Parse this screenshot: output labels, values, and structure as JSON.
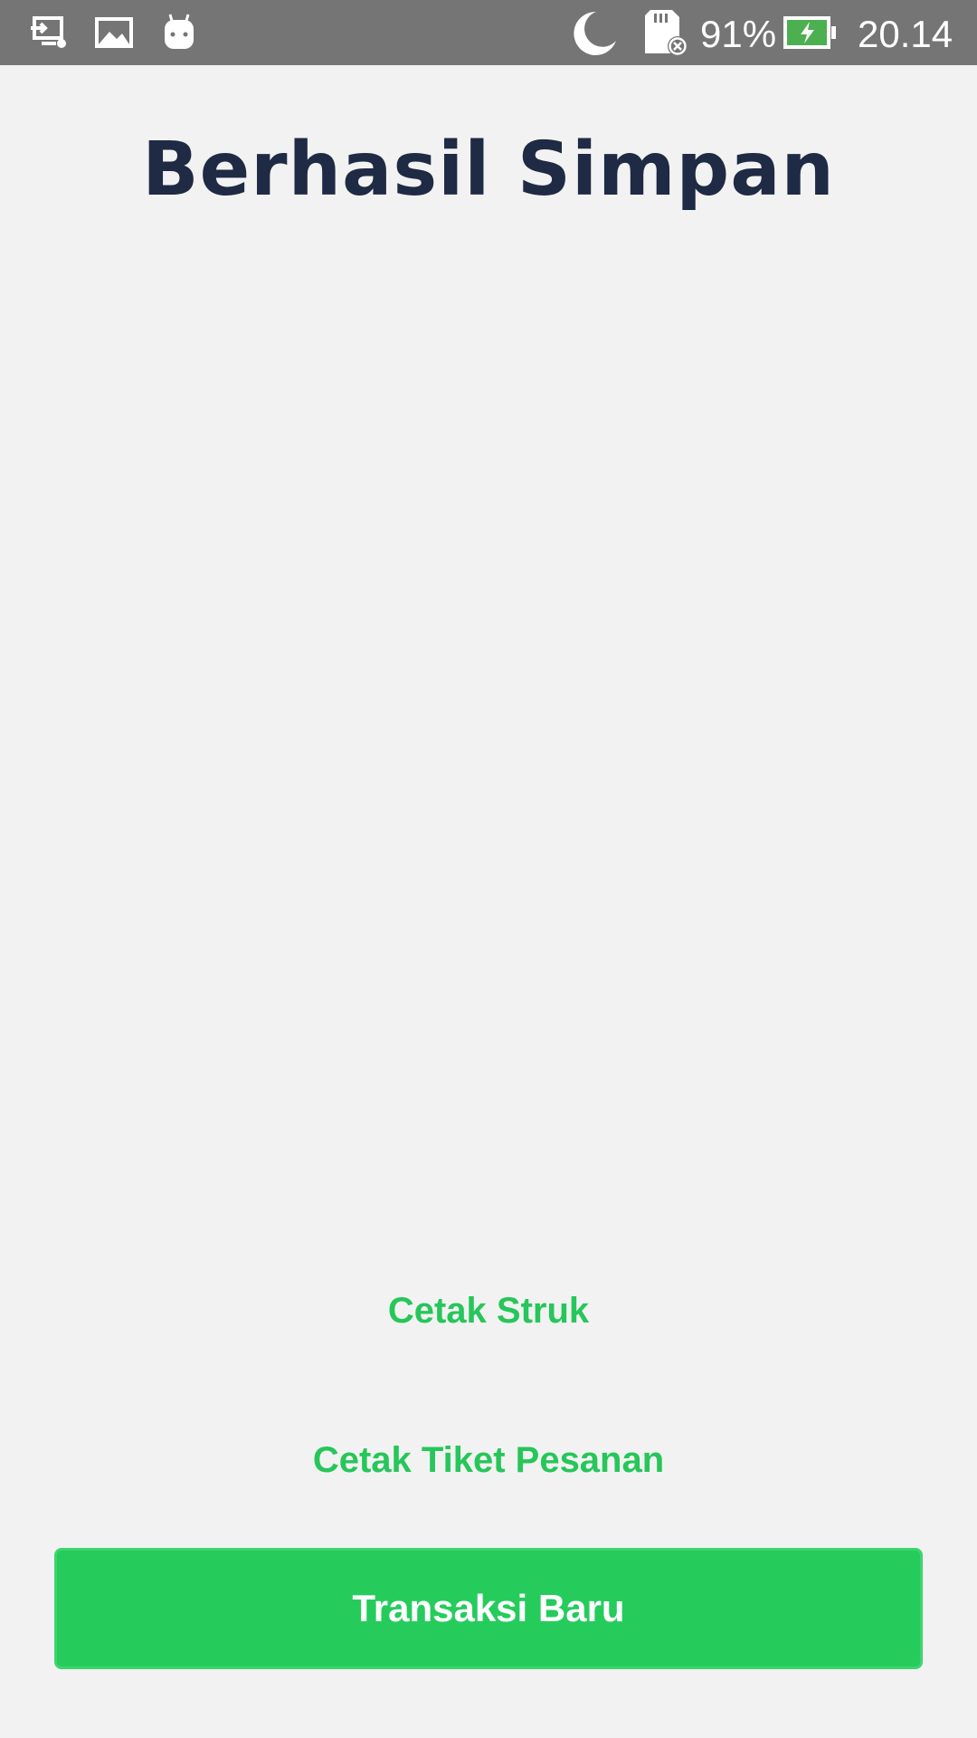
{
  "status_bar": {
    "icons_left": [
      "screen-cast-icon",
      "image-icon",
      "android-icon"
    ],
    "icons_right": [
      "moon-icon",
      "sd-card-error-icon",
      "battery-charging-icon"
    ],
    "battery_percent": "91%",
    "battery_level": 0.91,
    "time": "20.14"
  },
  "page": {
    "title": "Berhasil Simpan"
  },
  "actions": {
    "print_receipt_label": "Cetak Struk",
    "print_ticket_label": "Cetak Tiket Pesanan",
    "new_transaction_label": "Transaksi Baru"
  },
  "colors": {
    "status_bar_bg": "#757575",
    "background": "#f2f2f2",
    "title": "#1f2a44",
    "accent_green": "#25cc5c",
    "battery_fill": "#4caf50"
  }
}
